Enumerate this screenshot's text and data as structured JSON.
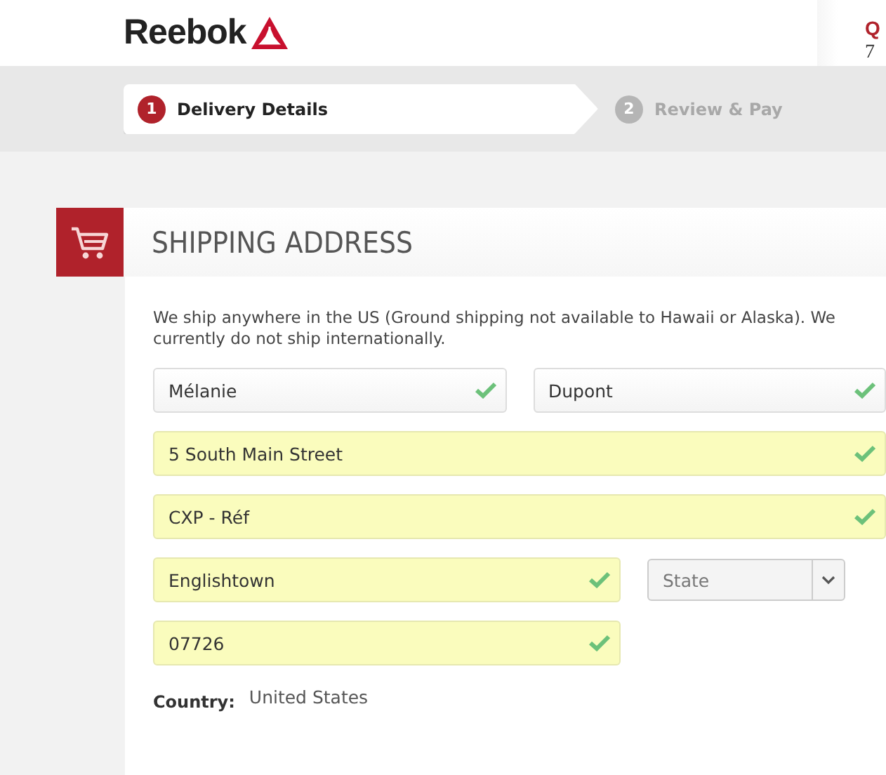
{
  "header": {
    "logo": "Reebok",
    "side_texts": [
      "Q",
      "7"
    ]
  },
  "steps": [
    {
      "number": "1",
      "label": "Delivery Details",
      "selected": true
    },
    {
      "number": "2",
      "label": "Review & Pay",
      "selected": false
    }
  ],
  "section": {
    "title": "SHIPPING ADDRESS",
    "intro": "We ship anywhere in the US (Ground shipping not available to Hawaii or Alaska). We currently do not ship internationally."
  },
  "rows": [
    {
      "fields": [
        {
          "kind": "text",
          "value": "Mélanie",
          "autofilled": false,
          "valid": true
        },
        {
          "kind": "text",
          "value": "Dupont",
          "autofilled": false,
          "valid": true
        }
      ]
    },
    {
      "fields": [
        {
          "kind": "text",
          "value": "5 South Main Street",
          "autofilled": true,
          "valid": true
        }
      ]
    },
    {
      "fields": [
        {
          "kind": "text",
          "value": "CXP - Réf",
          "autofilled": true,
          "valid": true
        }
      ]
    },
    {
      "fields": [
        {
          "kind": "text",
          "value": "Englishtown",
          "autofilled": true,
          "valid": true
        },
        {
          "kind": "select",
          "placeholder": "State"
        }
      ]
    },
    {
      "fields": [
        {
          "kind": "text",
          "value": "07726",
          "autofilled": true,
          "valid": true
        }
      ]
    }
  ],
  "country": {
    "label": "Country:",
    "value": "United States"
  }
}
